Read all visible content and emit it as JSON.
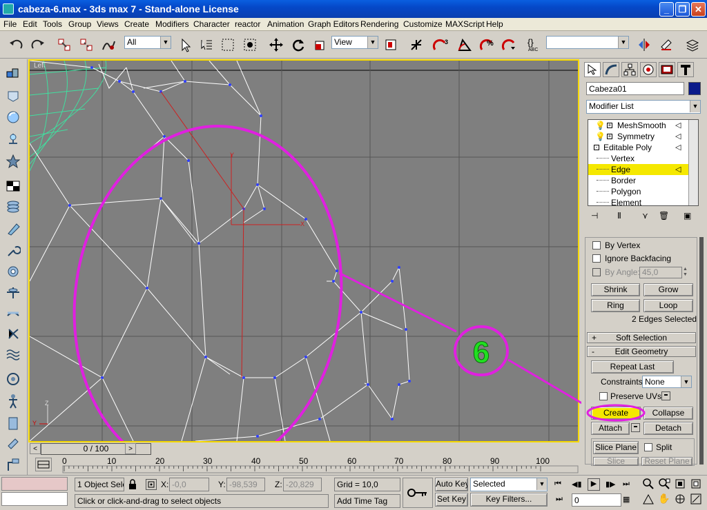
{
  "window": {
    "title": "cabeza-6.max - 3ds max 7 - Stand-alone License",
    "minimize": "_",
    "maximize": "❐",
    "close": "✕"
  },
  "menu": [
    "File",
    "Edit",
    "Tools",
    "Group",
    "Views",
    "Create",
    "Modifiers",
    "Character",
    "reactor",
    "Animation",
    "Graph Editors",
    "Rendering",
    "Customize",
    "MAXScript",
    "Help"
  ],
  "toolbar": {
    "selection_filter": "All",
    "ref_coord": "View",
    "named_selection": "",
    "snap_angle_label": "3",
    "percent_label": "%"
  },
  "viewport": {
    "label": "Left",
    "annotation_number": "6",
    "annotation_color": "#e020e0",
    "number_color": "#20e020",
    "axis_x": "X",
    "axis_y": "Y",
    "axis_z": "Z"
  },
  "timeline": {
    "slider_label": "0 / 100",
    "ticks": [
      "0",
      "10",
      "20",
      "30",
      "40",
      "50",
      "60",
      "70",
      "80",
      "90",
      "100"
    ]
  },
  "command_panel": {
    "object_name": "Cabeza01",
    "object_color": "#0a1a8a",
    "modifier_list": "Modifier List",
    "stack": [
      {
        "label": "MeshSmooth",
        "type": "modifier"
      },
      {
        "label": "Symmetry",
        "type": "modifier"
      },
      {
        "label": "Editable Poly",
        "type": "base"
      },
      {
        "label": "Vertex",
        "type": "sub"
      },
      {
        "label": "Edge",
        "type": "sub",
        "selected": true
      },
      {
        "label": "Border",
        "type": "sub"
      },
      {
        "label": "Polygon",
        "type": "sub"
      },
      {
        "label": "Element",
        "type": "sub"
      }
    ],
    "selection": {
      "by_vertex": "By Vertex",
      "ignore_backfacing": "Ignore Backfacing",
      "by_angle": "By Angle:",
      "angle_value": "45,0",
      "shrink": "Shrink",
      "grow": "Grow",
      "ring": "Ring",
      "loop": "Loop",
      "status": "2 Edges Selected"
    },
    "soft_selection": "Soft Selection",
    "edit_geometry": "Edit Geometry",
    "soft_pm": "+",
    "edit_pm": "-",
    "repeat_last": "Repeat Last",
    "constraints_label": "Constraints:",
    "constraints_value": "None",
    "preserve_uvs": "Preserve UVs",
    "create": "Create",
    "collapse": "Collapse",
    "attach": "Attach",
    "detach": "Detach",
    "slice_plane": "Slice Plane",
    "split": "Split",
    "slice": "Slice",
    "reset_plane": "Reset Plane"
  },
  "status": {
    "objects_selected": "1 Object Sele",
    "x_label": "X:",
    "x_value": "-0,0",
    "y_label": "Y:",
    "y_value": "-98,539",
    "z_label": "Z:",
    "z_value": "-20,829",
    "grid": "Grid = 10,0",
    "prompt": "Click or click-and-drag to select objects",
    "add_time_tag": "Add Time Tag",
    "auto_key": "Auto Key",
    "set_key": "Set Key",
    "selected_dropdown": "Selected",
    "key_filters": "Key Filters...",
    "frame": "0"
  },
  "colors": {
    "accent": "#f5d800",
    "viewport_bg": "#7f7f7f",
    "wire": "#ffffff",
    "selected_edge": "#cc2020",
    "other_mesh": "#40e0a0"
  }
}
